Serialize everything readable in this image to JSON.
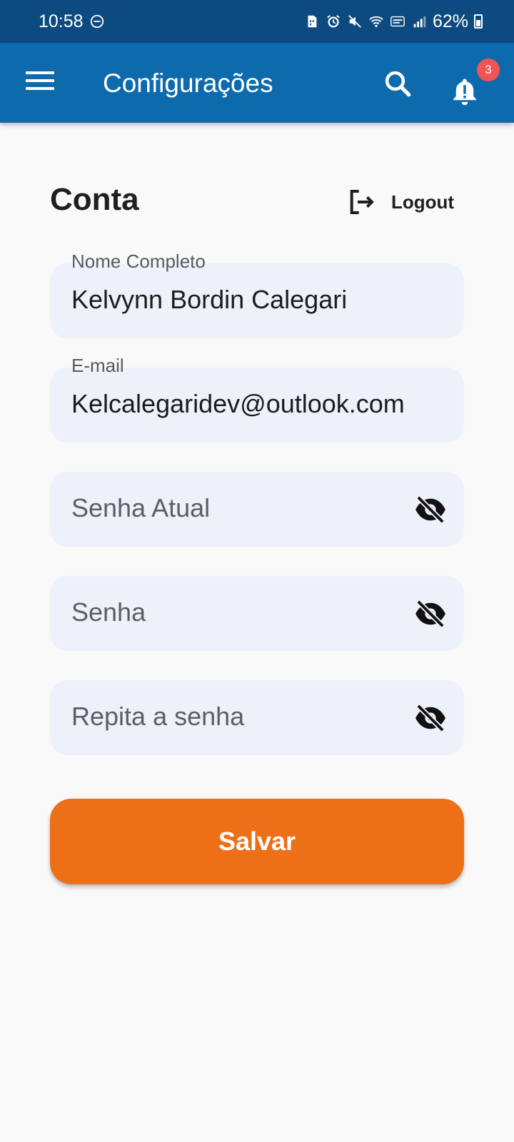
{
  "status_bar": {
    "time": "10:58",
    "battery": "62%",
    "icons": [
      "do-not-disturb-icon",
      "sim-icon",
      "alarm-icon",
      "mute-icon",
      "wifi-icon",
      "volte-icon",
      "signal-icon",
      "battery-icon"
    ]
  },
  "app_bar": {
    "title": "Configurações",
    "notification_count": "3"
  },
  "account": {
    "title": "Conta",
    "logout_label": "Logout"
  },
  "fields": {
    "full_name": {
      "label": "Nome Completo",
      "value": "Kelvynn Bordin Calegari"
    },
    "email": {
      "label": "E-mail",
      "value": "Kelcalegaridev@outlook.com"
    },
    "current_password": {
      "placeholder": "Senha Atual"
    },
    "password": {
      "placeholder": "Senha"
    },
    "repeat_password": {
      "placeholder": "Repita a senha"
    }
  },
  "save_label": "Salvar",
  "colors": {
    "status_bar": "#0d4a80",
    "app_bar": "#0d6aad",
    "badge": "#f05454",
    "field_bg": "#edf1f9",
    "save_button": "#ed6f17"
  }
}
